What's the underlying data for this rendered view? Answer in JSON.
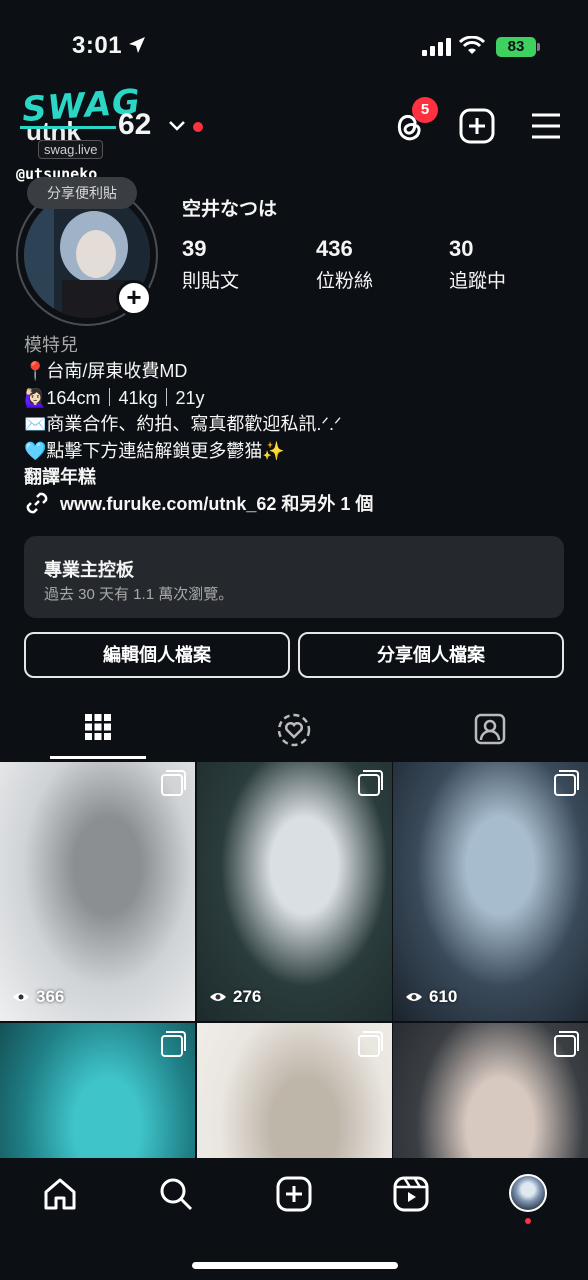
{
  "status_bar": {
    "time": "3:01",
    "battery": "83"
  },
  "header": {
    "brand_logo": "SWAG",
    "brand_old_text": "utnk",
    "brand_sub": "swag.live",
    "username_suffix": "62",
    "threads_badge": "5",
    "icons": [
      "threads-icon",
      "new-post-icon",
      "menu-icon"
    ]
  },
  "profile": {
    "handle_overlay": "@utsuneko",
    "note_bubble": "分享便利貼",
    "display_name": "空井なつは",
    "stats": [
      {
        "value": "39",
        "label": "則貼文"
      },
      {
        "value": "436",
        "label": "位粉絲"
      },
      {
        "value": "30",
        "label": "追蹤中"
      }
    ],
    "category": "模特兒",
    "bio_lines": [
      "📍台南/屏東收費MD",
      "🙋🏻‍♀️164cm｜41kg｜21y",
      "✉️商業合作、約拍、寫真都歡迎私訊.ᐟ.ᐟ",
      "🩵點擊下方連結解鎖更多鬱猫✨"
    ],
    "translate": "翻譯年糕",
    "link": "www.furuke.com/utnk_62 和另外 1 個"
  },
  "dashboard": {
    "title": "專業主控板",
    "subtitle": "過去 30 天有 1.1 萬次瀏覽。"
  },
  "buttons": {
    "edit": "編輯個人檔案",
    "share": "分享個人檔案"
  },
  "tabs": [
    "grid-icon",
    "reposts-icon",
    "tagged-icon"
  ],
  "posts": [
    {
      "views": "366",
      "colors": [
        "#cfd3d6",
        "#8b8f92",
        "#efeff0"
      ]
    },
    {
      "views": "276",
      "colors": [
        "#2b3c3c",
        "#dadfe3",
        "#1c2a2c"
      ]
    },
    {
      "views": "610",
      "colors": [
        "#3a4a5a",
        "#a7bccd",
        "#1a232c"
      ]
    },
    {
      "views": "",
      "colors": [
        "#1f7f86",
        "#3fc4c9",
        "#0f3a3e"
      ]
    },
    {
      "views": "",
      "colors": [
        "#e9e5df",
        "#bfb6aa",
        "#f5f2ee"
      ]
    },
    {
      "views": "",
      "colors": [
        "#3b3f44",
        "#d8c9c0",
        "#202326"
      ]
    }
  ],
  "nav": [
    "home-icon",
    "search-icon",
    "create-icon",
    "reels-icon",
    "profile-avatar"
  ]
}
